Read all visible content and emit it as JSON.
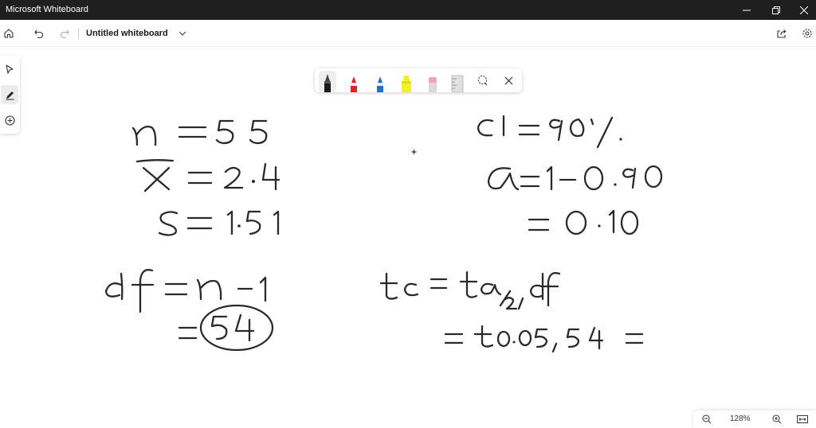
{
  "window": {
    "title": "Microsoft Whiteboard"
  },
  "toolbar": {
    "whiteboard_title": "Untitled whiteboard"
  },
  "rail": {
    "items": [
      {
        "icon": "select-arrow-icon"
      },
      {
        "icon": "pen-icon",
        "active": true
      },
      {
        "icon": "add-icon"
      }
    ]
  },
  "pen_tray": {
    "pens": [
      {
        "icon": "pen-black-icon",
        "color": "#1a1a1a",
        "selected": true
      },
      {
        "icon": "pen-red-icon",
        "color": "#e0232b"
      },
      {
        "icon": "pen-blue-icon",
        "color": "#1f6fd1"
      },
      {
        "icon": "highlighter-yellow-icon",
        "color": "#f5ef2a"
      },
      {
        "icon": "eraser-icon",
        "color": "#f2a3ab"
      },
      {
        "icon": "ruler-icon",
        "color": "#cfcfcf"
      }
    ],
    "tools": [
      {
        "icon": "lasso-select-icon"
      },
      {
        "icon": "close-icon"
      }
    ]
  },
  "canvas": {
    "ink_color": "#2a2a2a",
    "handwriting": [
      "n = 55",
      "x̄ = 2.4",
      "S = 1.51",
      "df = n - 1",
      "= 54",
      "CI = 90%",
      "α = 1 - 0.90",
      "= 0.10",
      "tc = tα/2, df",
      "= t0.05, 54 ="
    ]
  },
  "zoom": {
    "level": "128%"
  }
}
